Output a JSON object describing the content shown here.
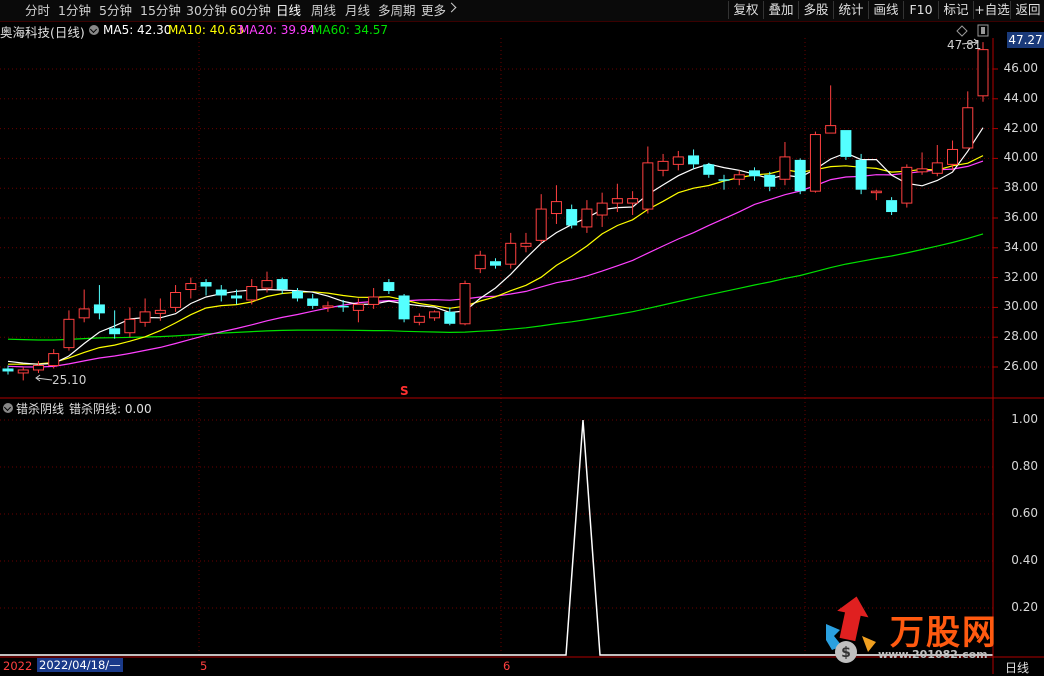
{
  "toolbar": {
    "tabs": [
      "分时",
      "1分钟",
      "5分钟",
      "15分钟",
      "30分钟",
      "60分钟",
      "日线",
      "周线",
      "月线",
      "多周期",
      "更多"
    ],
    "active_tab": "日线",
    "right_buttons": [
      "复权",
      "叠加",
      "多股",
      "统计",
      "画线",
      "F10",
      "标记",
      "+自选",
      "返回"
    ]
  },
  "stock": {
    "title": "奥海科技(日线)",
    "ma5": "MA5: 42.30",
    "ma10": "MA10: 40.63",
    "ma20": "MA20: 39.94",
    "ma60": "MA60: 34.57",
    "current_price": "47.27",
    "high_label": "47.81",
    "low_label": "25.10",
    "signal_marker": "S"
  },
  "indicator": {
    "name": "错杀阴线",
    "value_label": "错杀阴线: 0.00"
  },
  "price_axis": [
    "46.00",
    "44.00",
    "42.00",
    "40.00",
    "38.00",
    "36.00",
    "34.00",
    "32.00",
    "30.00",
    "28.00",
    "26.00"
  ],
  "indicator_axis": [
    "1.00",
    "0.80",
    "0.60",
    "0.40",
    "0.20"
  ],
  "time_axis": {
    "start": "2022",
    "cursor_date": "2022/04/18/—",
    "months": [
      "5",
      "6"
    ],
    "period": "日线"
  },
  "watermark": {
    "brand": "万股网",
    "url": "www.201082.com"
  },
  "colors": {
    "up": "#ff4040",
    "down": "#54ffff",
    "ma5": "#ffffff",
    "ma10": "#ffff00",
    "ma20": "#ff40ff",
    "ma60": "#00e000",
    "grid": "#6a0000"
  }
}
